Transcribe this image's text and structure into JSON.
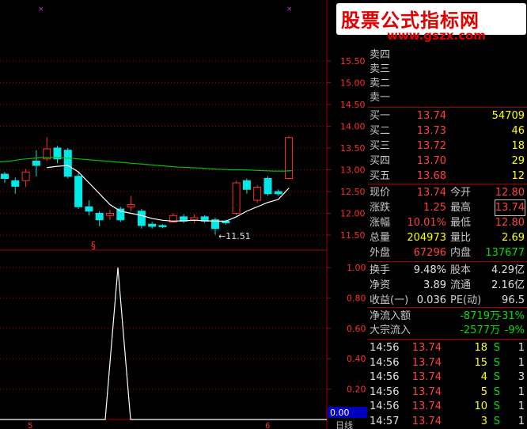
{
  "watermark": {
    "title": "股票公式指标网",
    "url": "www.gszx.com"
  },
  "price_axis": [
    "15.50",
    "15.00",
    "14.50",
    "14.00",
    "13.50",
    "13.00",
    "12.50",
    "12.00",
    "11.50"
  ],
  "ind_axis": [
    "1.00",
    "0.80",
    "0.60",
    "0.40",
    "0.20"
  ],
  "ind_value": "0.00",
  "low_annotation": "←11.51",
  "marker_symbol": "§",
  "x_labels": [
    "5",
    "6"
  ],
  "period_label": "日线",
  "candles": [
    {
      "o": 12.9,
      "c": 12.8,
      "h": 12.95,
      "l": 12.7
    },
    {
      "o": 12.75,
      "c": 12.62,
      "h": 12.82,
      "l": 12.45
    },
    {
      "o": 12.75,
      "c": 12.95,
      "h": 13.02,
      "l": 12.6
    },
    {
      "o": 13.2,
      "c": 13.1,
      "h": 13.45,
      "l": 12.85
    },
    {
      "o": 13.25,
      "c": 13.48,
      "h": 13.75,
      "l": 13.2
    },
    {
      "o": 13.5,
      "c": 13.25,
      "h": 13.55,
      "l": 13.15
    },
    {
      "o": 13.45,
      "c": 12.85,
      "h": 13.5,
      "l": 12.8
    },
    {
      "o": 12.85,
      "c": 12.15,
      "h": 12.95,
      "l": 12.1
    },
    {
      "o": 12.15,
      "c": 12.05,
      "h": 12.3,
      "l": 11.95
    },
    {
      "o": 12.0,
      "c": 11.85,
      "h": 12.05,
      "l": 11.7
    },
    {
      "o": 11.95,
      "c": 12.0,
      "h": 12.08,
      "l": 11.85
    },
    {
      "o": 12.1,
      "c": 11.85,
      "h": 12.15,
      "l": 11.8
    },
    {
      "o": 12.15,
      "c": 12.2,
      "h": 12.4,
      "l": 12.05
    },
    {
      "o": 12.05,
      "c": 11.72,
      "h": 12.1,
      "l": 11.65
    },
    {
      "o": 11.75,
      "c": 11.7,
      "h": 11.8,
      "l": 11.65
    },
    {
      "o": 11.72,
      "c": 11.7,
      "h": 11.75,
      "l": 11.66
    },
    {
      "o": 11.8,
      "c": 11.95,
      "h": 12.0,
      "l": 11.78
    },
    {
      "o": 11.92,
      "c": 11.82,
      "h": 11.98,
      "l": 11.78
    },
    {
      "o": 11.85,
      "c": 11.9,
      "h": 11.98,
      "l": 11.78
    },
    {
      "o": 11.92,
      "c": 11.82,
      "h": 11.96,
      "l": 11.78
    },
    {
      "o": 11.85,
      "c": 11.65,
      "h": 11.9,
      "l": 11.51
    },
    {
      "o": 11.82,
      "c": 11.78,
      "h": 11.85,
      "l": 11.74
    },
    {
      "o": 12.0,
      "c": 12.7,
      "h": 12.75,
      "l": 11.95
    },
    {
      "o": 12.75,
      "c": 12.55,
      "h": 12.8,
      "l": 12.45
    },
    {
      "o": 12.3,
      "c": 12.6,
      "h": 12.65,
      "l": 12.25
    },
    {
      "o": 12.8,
      "c": 12.45,
      "h": 12.85,
      "l": 12.4
    },
    {
      "o": 12.5,
      "c": 12.45,
      "h": 12.55,
      "l": 12.4
    },
    {
      "o": 12.8,
      "c": 13.74,
      "h": 13.78,
      "l": 12.78
    }
  ],
  "orderbook": {
    "sell": [
      {
        "label": "卖四"
      },
      {
        "label": "卖三"
      },
      {
        "label": "卖二"
      },
      {
        "label": "卖一"
      }
    ],
    "buy": [
      {
        "label": "买一",
        "price": "13.74",
        "vol": "54709"
      },
      {
        "label": "买二",
        "price": "13.73",
        "vol": "46"
      },
      {
        "label": "买三",
        "price": "13.72",
        "vol": "18"
      },
      {
        "label": "买四",
        "price": "13.70",
        "vol": "29"
      },
      {
        "label": "买五",
        "price": "13.68",
        "vol": "12"
      }
    ]
  },
  "quote": [
    {
      "l1": "现价",
      "v1": "13.74",
      "l2": "今开",
      "v2": "12.80"
    },
    {
      "l1": "涨跌",
      "v1": "1.25",
      "l2": "最高",
      "v2": "13.74"
    },
    {
      "l1": "涨幅",
      "v1": "10.01%",
      "l2": "最低",
      "v2": "12.80"
    },
    {
      "l1": "总量",
      "v1": "204973",
      "l2": "量比",
      "v2": "2.69"
    },
    {
      "l1": "外盘",
      "v1": "67296",
      "l2": "内盘",
      "v2": "137677"
    }
  ],
  "fundamentals": [
    {
      "l1": "换手",
      "v1": "9.48%",
      "l2": "股本",
      "v2": "4.29亿"
    },
    {
      "l1": "净资",
      "v1": "3.89",
      "l2": "流通",
      "v2": "2.16亿"
    },
    {
      "l1": "收益(一)",
      "v1": "0.036",
      "l2": "PE(动)",
      "v2": "96.5"
    }
  ],
  "flows": [
    {
      "label": "净流入额",
      "amount": "-8719万",
      "pct": "-31%"
    },
    {
      "label": "大宗流入",
      "amount": "-2577万",
      "pct": "-9%"
    }
  ],
  "ticks": [
    {
      "time": "14:56",
      "price": "13.74",
      "vol": "18",
      "side": "S",
      "n": "1"
    },
    {
      "time": "14:56",
      "price": "13.74",
      "vol": "15",
      "side": "S",
      "n": "1"
    },
    {
      "time": "14:56",
      "price": "13.74",
      "vol": "4",
      "side": "S",
      "n": "3"
    },
    {
      "time": "14:56",
      "price": "13.74",
      "vol": "5",
      "side": "S",
      "n": "1"
    },
    {
      "time": "14:56",
      "price": "13.74",
      "vol": "10",
      "side": "S",
      "n": "1"
    },
    {
      "time": "14:57",
      "price": "13.74",
      "vol": "3",
      "side": "S",
      "n": "1"
    }
  ],
  "colors": {
    "up": "#ff3030",
    "down": "#00e8e8",
    "ma": "#00c000",
    "grid": "#a00000",
    "ma_white": "#ffffff"
  }
}
